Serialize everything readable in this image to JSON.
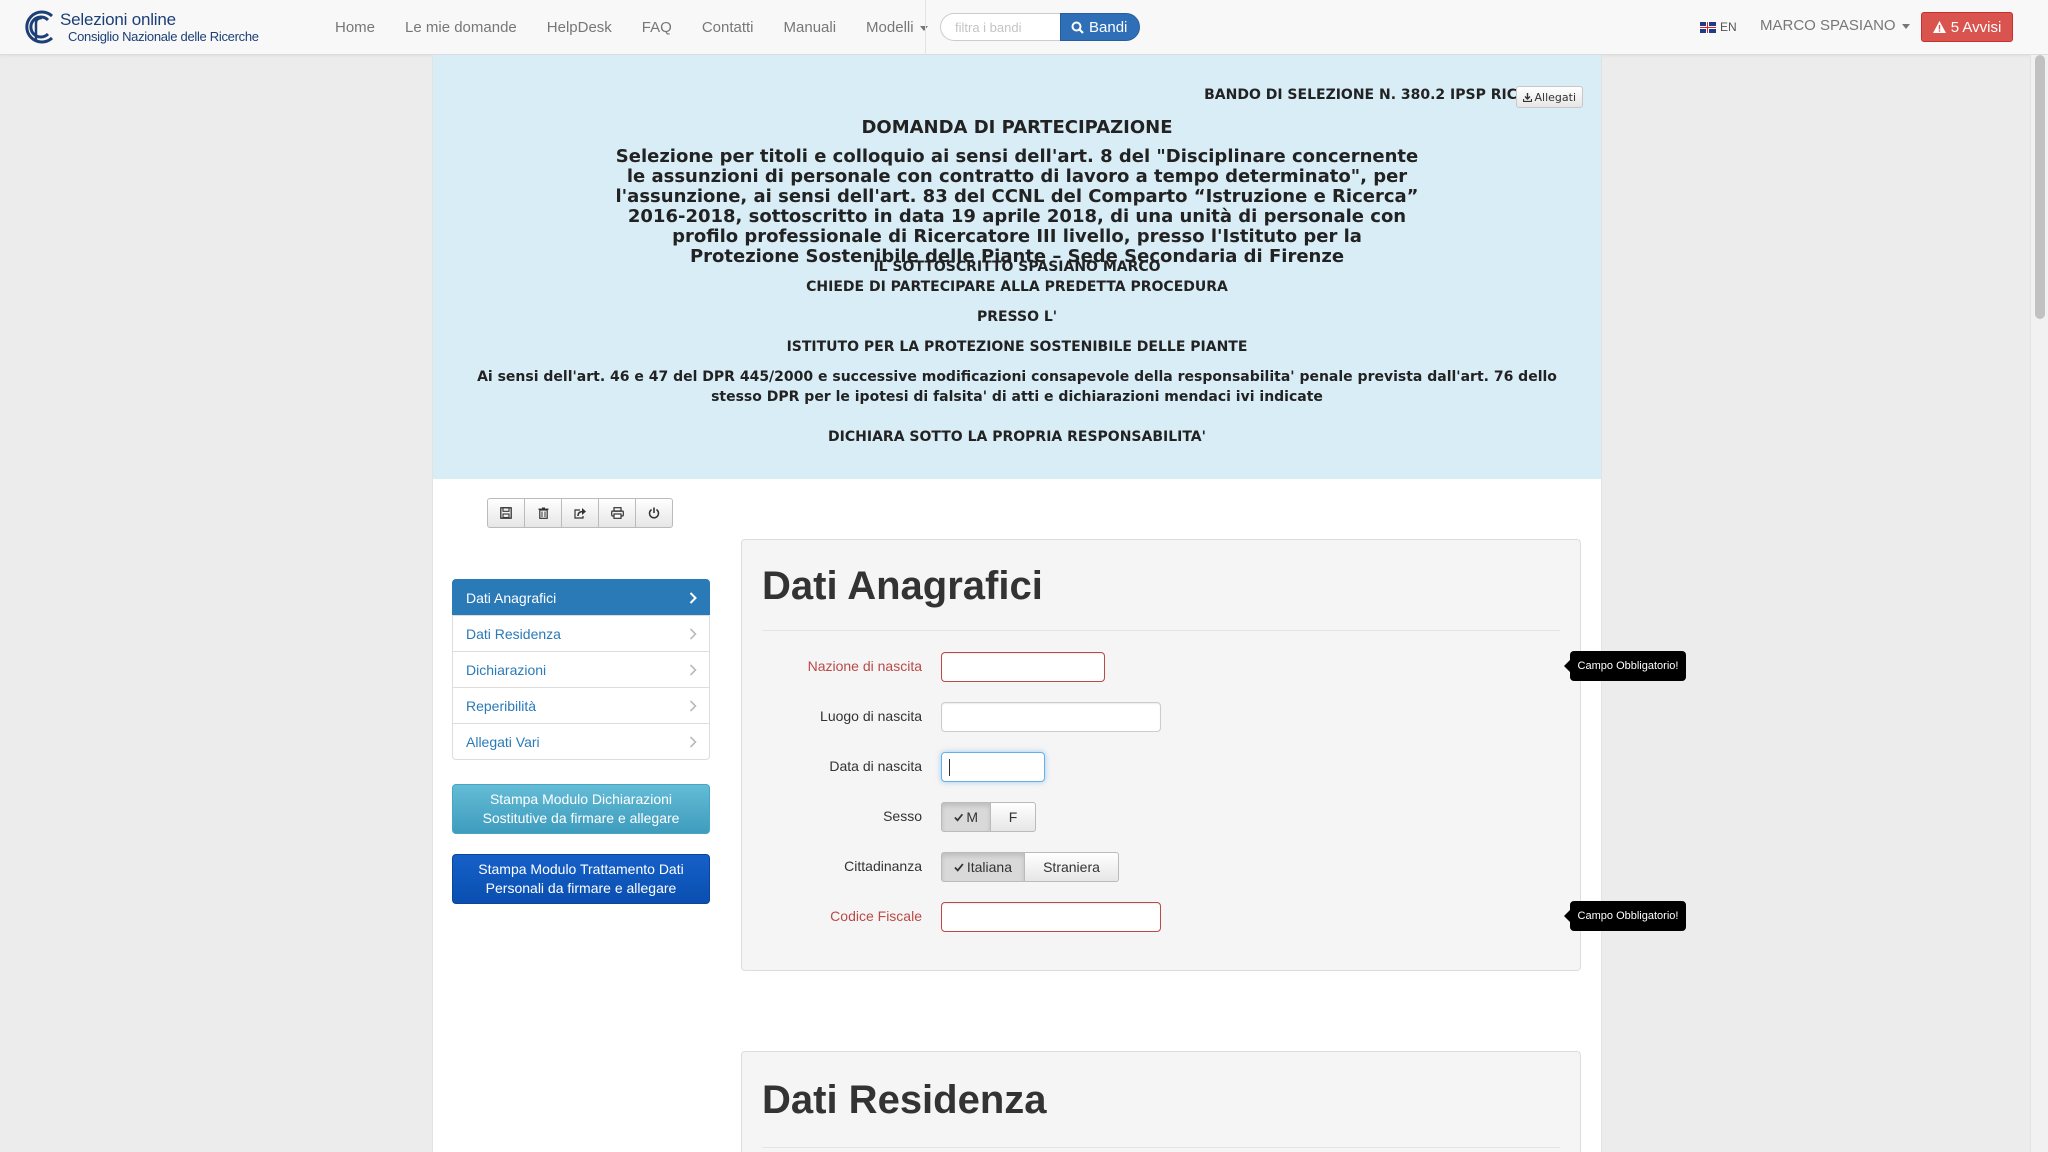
{
  "brand": {
    "title": "Selezioni online",
    "subtitle": "Consiglio Nazionale delle Ricerche"
  },
  "nav": {
    "items": [
      "Home",
      "Le mie domande",
      "HelpDesk",
      "FAQ",
      "Contatti",
      "Manuali",
      "Modelli"
    ],
    "search_placeholder": "filtra i bandi",
    "search_button": "Bandi",
    "lang": "EN",
    "user": "MARCO SPASIANO",
    "alerts": "5 Avvisi"
  },
  "header": {
    "bando": "BANDO DI SELEZIONE N. 380.2 IPSP RIC",
    "allegati": "Allegati",
    "domanda": "DOMANDA DI PARTECIPAZIONE",
    "selezione": "Selezione per titoli e colloquio ai sensi dell'art. 8 del \"Disciplinare concernente le assunzioni di personale con contratto di lavoro a tempo determinato\", per l'assunzione, ai sensi dell'art. 83 del CCNL del Comparto “Istruzione e Ricerca” 2016-2018, sottoscritto in data 19 aprile 2018, di una unità di personale con profilo professionale di Ricercatore III livello, presso l'Istituto per la Protezione Sostenibile delle Piante – Sede Secondaria di Firenze",
    "sottoscritto": "IL SOTTOSCRITTO SPASIANO MARCO",
    "chiede": "CHIEDE DI PARTECIPARE ALLA PREDETTA PROCEDURA",
    "presso": "PRESSO L'",
    "istituto": "ISTITUTO PER LA PROTEZIONE SOSTENIBILE DELLE PIANTE",
    "ai_sensi": "Ai sensi dell'art. 46 e 47 del DPR 445/2000 e successive modificazioni consapevole della responsabilita' penale prevista dall'art. 76 dello stesso DPR per le ipotesi di falsita' di atti e dichiarazioni mendaci ivi indicate",
    "dichiara": "DICHIARA SOTTO LA PROPRIA RESPONSABILITA'"
  },
  "sidebar": {
    "items": [
      "Dati Anagrafici",
      "Dati Residenza",
      "Dichiarazioni",
      "Reperibilità",
      "Allegati Vari"
    ],
    "btn_dichiarazioni": "Stampa Modulo Dichiarazioni Sostitutive da firmare e allegare",
    "btn_trattamento": "Stampa Modulo Trattamento Dati Personali da firmare e allegare"
  },
  "form": {
    "title": "Dati Anagrafici",
    "nazione_label": "Nazione di nascita",
    "luogo_label": "Luogo di nascita",
    "data_label": "Data di nascita",
    "sesso_label": "Sesso",
    "sesso_m": "M",
    "sesso_f": "F",
    "cittadinanza_label": "Cittadinanza",
    "cittadinanza_italiana": "Italiana",
    "cittadinanza_straniera": "Straniera",
    "cf_label": "Codice Fiscale",
    "tooltip": "Campo Obbligatorio!"
  },
  "form2": {
    "title": "Dati Residenza"
  },
  "colors": {
    "header_bg": "#d9edf7",
    "primary": "#2a7ab8",
    "danger": "#d9534f",
    "error": "#b94a48"
  }
}
